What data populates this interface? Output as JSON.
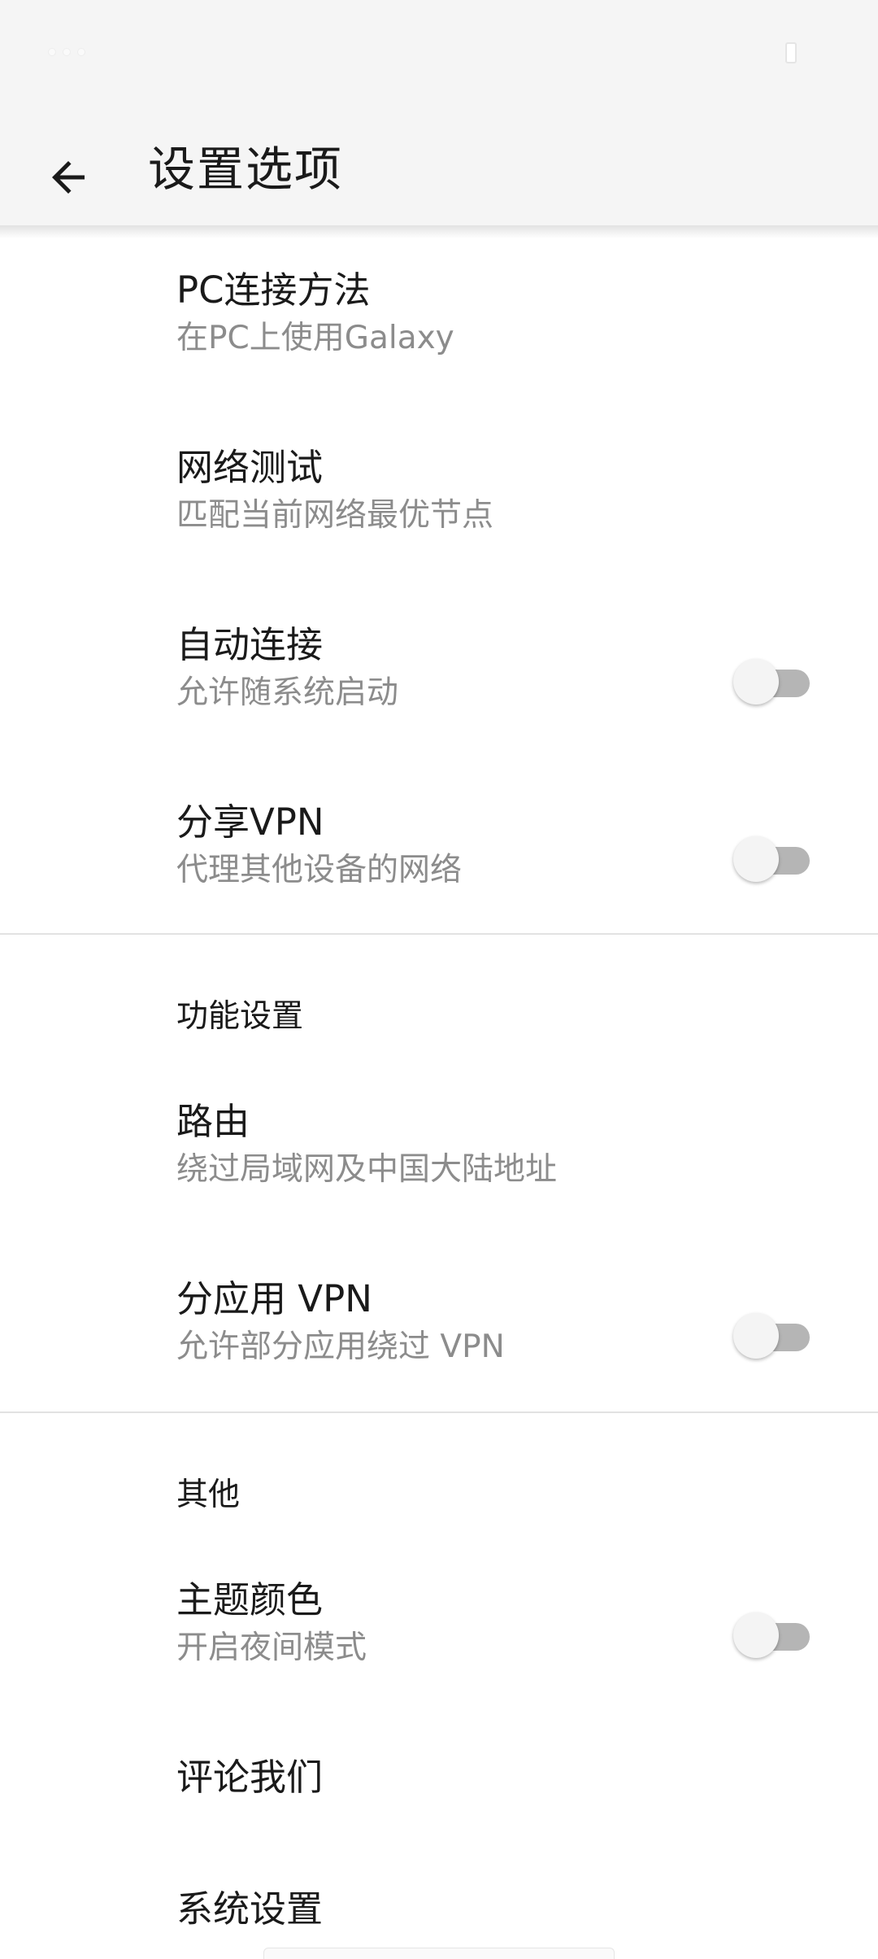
{
  "header": {
    "title": "设置选项",
    "back_icon": "arrow-left-icon"
  },
  "settings": {
    "pc_connect": {
      "title": "PC连接方法",
      "subtitle": "在PC上使用Galaxy"
    },
    "network_test": {
      "title": "网络测试",
      "subtitle": "匹配当前网络最优节点"
    },
    "auto_connect": {
      "title": "自动连接",
      "subtitle": "允许随系统启动",
      "enabled": false
    },
    "share_vpn": {
      "title": "分享VPN",
      "subtitle": "代理其他设备的网络",
      "enabled": false
    }
  },
  "features": {
    "header": "功能设置",
    "routing": {
      "title": "路由",
      "subtitle": "绕过局域网及中国大陆地址"
    },
    "per_app_vpn": {
      "title": "分应用 VPN",
      "subtitle": "允许部分应用绕过 VPN",
      "enabled": false
    }
  },
  "other": {
    "header": "其他",
    "theme_color": {
      "title": "主题颜色",
      "subtitle": "开启夜间模式",
      "enabled": false
    },
    "review_us": {
      "title": "评论我们"
    },
    "system_settings": {
      "title": "系统设置"
    }
  },
  "colors": {
    "app_bar": "#f5f5f5",
    "primary_text": "#1a1a1a",
    "secondary_text": "#8c8c8c",
    "divider": "#e2e2e2",
    "switch_track_off": "#b5b5b5",
    "switch_thumb_off": "#f4f4f4"
  }
}
